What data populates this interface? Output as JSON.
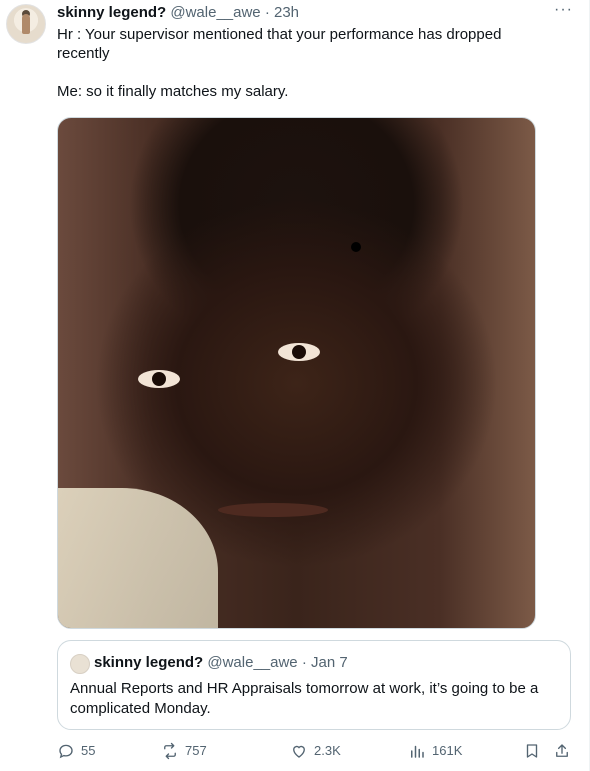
{
  "tweet": {
    "display_name": "skinny legend?",
    "handle": "@wale__awe",
    "separator": "·",
    "time": "23h",
    "text_line1": "Hr : Your supervisor mentioned that  your performance has dropped recently",
    "text_line2": "Me: so it finally matches my salary.",
    "more_label": "···"
  },
  "quote": {
    "display_name": "skinny legend?",
    "handle": "@wale__awe",
    "separator": "·",
    "date": "Jan 7",
    "text": "Annual Reports and HR Appraisals tomorrow at work, it’s going to be a complicated Monday."
  },
  "actions": {
    "replies": "55",
    "reposts": "757",
    "likes": "2.3K",
    "views": "161K"
  },
  "icons": {
    "reply": "reply-icon",
    "repost": "repost-icon",
    "like": "heart-icon",
    "views": "views-icon",
    "bookmark": "bookmark-icon",
    "share": "share-icon"
  }
}
